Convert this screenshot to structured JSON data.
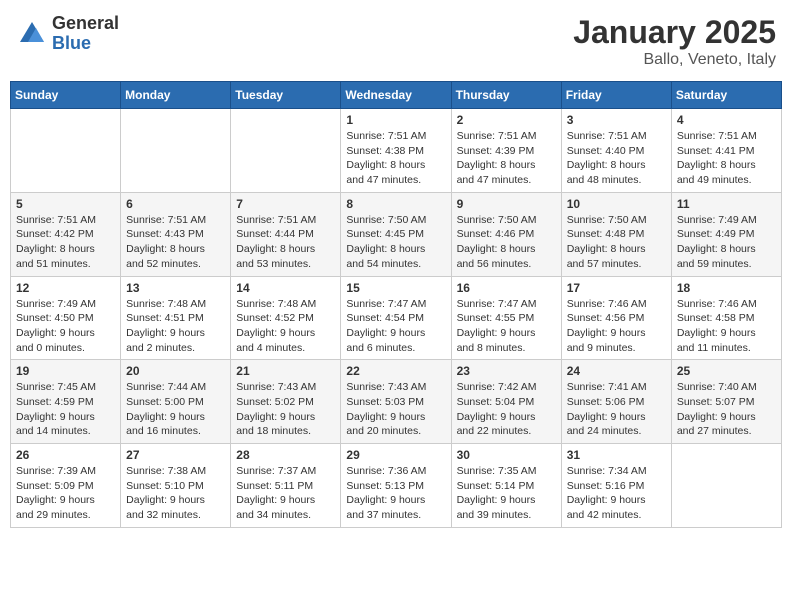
{
  "header": {
    "logo_general": "General",
    "logo_blue": "Blue",
    "month_title": "January 2025",
    "location": "Ballo, Veneto, Italy"
  },
  "days_of_week": [
    "Sunday",
    "Monday",
    "Tuesday",
    "Wednesday",
    "Thursday",
    "Friday",
    "Saturday"
  ],
  "weeks": [
    [
      {
        "day": "",
        "info": ""
      },
      {
        "day": "",
        "info": ""
      },
      {
        "day": "",
        "info": ""
      },
      {
        "day": "1",
        "info": "Sunrise: 7:51 AM\nSunset: 4:38 PM\nDaylight: 8 hours and 47 minutes."
      },
      {
        "day": "2",
        "info": "Sunrise: 7:51 AM\nSunset: 4:39 PM\nDaylight: 8 hours and 47 minutes."
      },
      {
        "day": "3",
        "info": "Sunrise: 7:51 AM\nSunset: 4:40 PM\nDaylight: 8 hours and 48 minutes."
      },
      {
        "day": "4",
        "info": "Sunrise: 7:51 AM\nSunset: 4:41 PM\nDaylight: 8 hours and 49 minutes."
      }
    ],
    [
      {
        "day": "5",
        "info": "Sunrise: 7:51 AM\nSunset: 4:42 PM\nDaylight: 8 hours and 51 minutes."
      },
      {
        "day": "6",
        "info": "Sunrise: 7:51 AM\nSunset: 4:43 PM\nDaylight: 8 hours and 52 minutes."
      },
      {
        "day": "7",
        "info": "Sunrise: 7:51 AM\nSunset: 4:44 PM\nDaylight: 8 hours and 53 minutes."
      },
      {
        "day": "8",
        "info": "Sunrise: 7:50 AM\nSunset: 4:45 PM\nDaylight: 8 hours and 54 minutes."
      },
      {
        "day": "9",
        "info": "Sunrise: 7:50 AM\nSunset: 4:46 PM\nDaylight: 8 hours and 56 minutes."
      },
      {
        "day": "10",
        "info": "Sunrise: 7:50 AM\nSunset: 4:48 PM\nDaylight: 8 hours and 57 minutes."
      },
      {
        "day": "11",
        "info": "Sunrise: 7:49 AM\nSunset: 4:49 PM\nDaylight: 8 hours and 59 minutes."
      }
    ],
    [
      {
        "day": "12",
        "info": "Sunrise: 7:49 AM\nSunset: 4:50 PM\nDaylight: 9 hours and 0 minutes."
      },
      {
        "day": "13",
        "info": "Sunrise: 7:48 AM\nSunset: 4:51 PM\nDaylight: 9 hours and 2 minutes."
      },
      {
        "day": "14",
        "info": "Sunrise: 7:48 AM\nSunset: 4:52 PM\nDaylight: 9 hours and 4 minutes."
      },
      {
        "day": "15",
        "info": "Sunrise: 7:47 AM\nSunset: 4:54 PM\nDaylight: 9 hours and 6 minutes."
      },
      {
        "day": "16",
        "info": "Sunrise: 7:47 AM\nSunset: 4:55 PM\nDaylight: 9 hours and 8 minutes."
      },
      {
        "day": "17",
        "info": "Sunrise: 7:46 AM\nSunset: 4:56 PM\nDaylight: 9 hours and 9 minutes."
      },
      {
        "day": "18",
        "info": "Sunrise: 7:46 AM\nSunset: 4:58 PM\nDaylight: 9 hours and 11 minutes."
      }
    ],
    [
      {
        "day": "19",
        "info": "Sunrise: 7:45 AM\nSunset: 4:59 PM\nDaylight: 9 hours and 14 minutes."
      },
      {
        "day": "20",
        "info": "Sunrise: 7:44 AM\nSunset: 5:00 PM\nDaylight: 9 hours and 16 minutes."
      },
      {
        "day": "21",
        "info": "Sunrise: 7:43 AM\nSunset: 5:02 PM\nDaylight: 9 hours and 18 minutes."
      },
      {
        "day": "22",
        "info": "Sunrise: 7:43 AM\nSunset: 5:03 PM\nDaylight: 9 hours and 20 minutes."
      },
      {
        "day": "23",
        "info": "Sunrise: 7:42 AM\nSunset: 5:04 PM\nDaylight: 9 hours and 22 minutes."
      },
      {
        "day": "24",
        "info": "Sunrise: 7:41 AM\nSunset: 5:06 PM\nDaylight: 9 hours and 24 minutes."
      },
      {
        "day": "25",
        "info": "Sunrise: 7:40 AM\nSunset: 5:07 PM\nDaylight: 9 hours and 27 minutes."
      }
    ],
    [
      {
        "day": "26",
        "info": "Sunrise: 7:39 AM\nSunset: 5:09 PM\nDaylight: 9 hours and 29 minutes."
      },
      {
        "day": "27",
        "info": "Sunrise: 7:38 AM\nSunset: 5:10 PM\nDaylight: 9 hours and 32 minutes."
      },
      {
        "day": "28",
        "info": "Sunrise: 7:37 AM\nSunset: 5:11 PM\nDaylight: 9 hours and 34 minutes."
      },
      {
        "day": "29",
        "info": "Sunrise: 7:36 AM\nSunset: 5:13 PM\nDaylight: 9 hours and 37 minutes."
      },
      {
        "day": "30",
        "info": "Sunrise: 7:35 AM\nSunset: 5:14 PM\nDaylight: 9 hours and 39 minutes."
      },
      {
        "day": "31",
        "info": "Sunrise: 7:34 AM\nSunset: 5:16 PM\nDaylight: 9 hours and 42 minutes."
      },
      {
        "day": "",
        "info": ""
      }
    ]
  ]
}
